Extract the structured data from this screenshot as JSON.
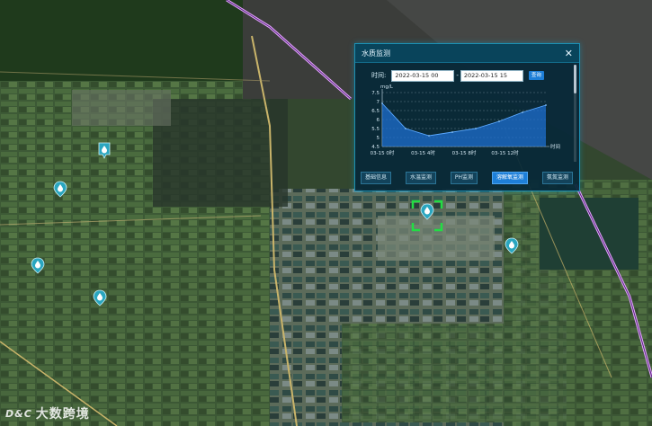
{
  "panel": {
    "title": "水质监测",
    "time_label": "时间:",
    "start_time": "2022-03-15 00",
    "end_time": "2022-03-15 15",
    "time_separator": "-",
    "query_label": "查询",
    "tabs": [
      {
        "label": "基础信息",
        "active": false
      },
      {
        "label": "水温监测",
        "active": false
      },
      {
        "label": "PH监测",
        "active": false
      },
      {
        "label": "溶解氧监测",
        "active": true
      },
      {
        "label": "氨氮监测",
        "active": false
      }
    ]
  },
  "chart_data": {
    "type": "area",
    "ylabel": "mg/L",
    "xlabel": "时间",
    "ylim": [
      4.5,
      7.5
    ],
    "yticks": [
      4.5,
      5,
      5.5,
      6,
      6.5,
      7,
      7.5
    ],
    "xtick_labels": [
      "03-15 0时",
      "03-15 4时",
      "03-15 8时",
      "03-15 12时"
    ],
    "x": [
      0,
      2,
      4,
      6,
      8,
      10,
      12,
      14
    ],
    "values": [
      6.9,
      5.5,
      5.1,
      5.3,
      5.5,
      5.9,
      6.4,
      6.8
    ],
    "color": "#1e6fd0"
  },
  "watermark": {
    "logo_text": "D&C",
    "name": "大数跨境"
  },
  "colors": {
    "panel_border": "#1c8fb2",
    "active_tab": "#1e7fd8",
    "target_marker": "#22dd44",
    "map_marker": "#2aa6bf"
  },
  "markers": [
    {
      "icon": "water-drop-icon"
    },
    {
      "icon": "water-drop-icon"
    },
    {
      "icon": "water-drop-icon"
    },
    {
      "icon": "water-drop-icon"
    },
    {
      "icon": "water-drop-icon"
    },
    {
      "icon": "water-drop-icon"
    }
  ]
}
